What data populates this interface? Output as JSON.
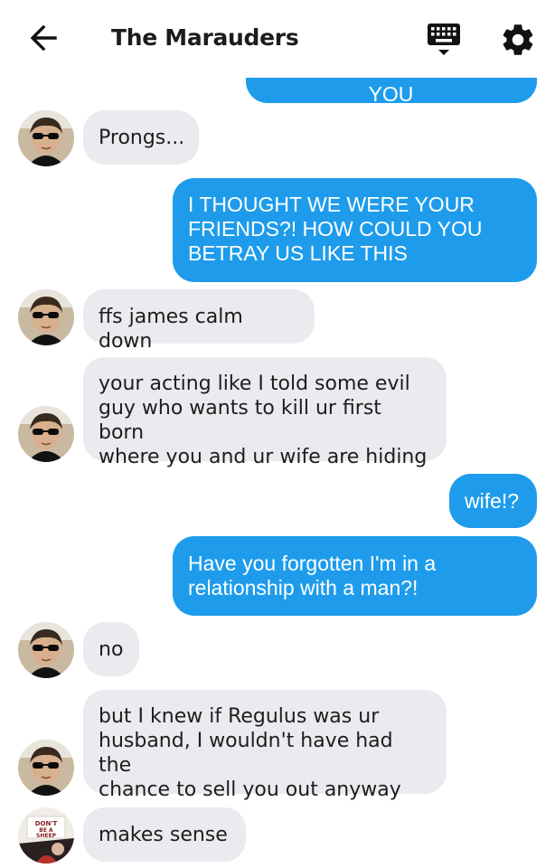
{
  "header": {
    "title": "The Marauders",
    "back_icon": "arrow-left-icon",
    "keyboard_icon": "keyboard-icon",
    "settings_icon": "gear-icon"
  },
  "colors": {
    "outgoing_bubble": "#1e9ceb",
    "incoming_bubble": "#e9ebee"
  },
  "messages": [
    {
      "direction": "outgoing",
      "text": "WORMY HOW COULD YOU"
    },
    {
      "direction": "incoming",
      "avatar": "avatar-sunglasses",
      "text": "Prongs..."
    },
    {
      "direction": "outgoing",
      "text": "I THOUGHT WE WERE YOUR\nFRIENDS?! HOW COULD YOU\nBETRAY US LIKE THIS"
    },
    {
      "direction": "incoming",
      "avatar": "avatar-sunglasses",
      "text": "ffs james calm down"
    },
    {
      "direction": "incoming",
      "avatar": "avatar-sunglasses",
      "text": "your acting like I told some evil\nguy who wants to kill ur first born\nwhere you and ur wife are hiding"
    },
    {
      "direction": "outgoing",
      "text": "wife!?"
    },
    {
      "direction": "outgoing",
      "text": "Have you forgotten I'm in a\nrelationship with a man?!"
    },
    {
      "direction": "incoming",
      "avatar": "avatar-sunglasses",
      "text": "no"
    },
    {
      "direction": "incoming",
      "avatar": "avatar-sunglasses",
      "text": "but I knew if Regulus was ur\nhusband, I wouldn't have had the\nchance to sell you out anyway"
    },
    {
      "direction": "incoming",
      "avatar": "avatar-dont-be-a-sheep",
      "avatar_text": "DON'T BE A SHEEP",
      "text": "makes sense"
    }
  ]
}
